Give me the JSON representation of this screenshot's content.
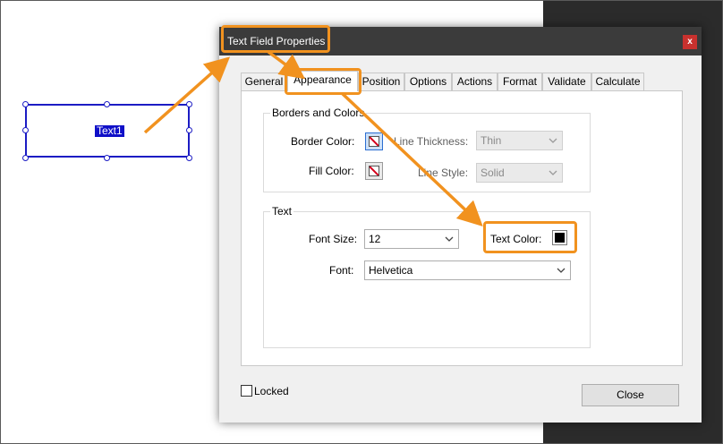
{
  "document": {
    "field_name": "Text1"
  },
  "dialog": {
    "title": "Text Field Properties",
    "close_glyph": "x",
    "tabs": [
      {
        "label": "General"
      },
      {
        "label": "Appearance"
      },
      {
        "label": "Position"
      },
      {
        "label": "Options"
      },
      {
        "label": "Actions"
      },
      {
        "label": "Format"
      },
      {
        "label": "Validate"
      },
      {
        "label": "Calculate"
      }
    ],
    "active_tab": "Appearance",
    "borders_and_colors": {
      "legend": "Borders and Colors",
      "border_color_label": "Border Color:",
      "fill_color_label": "Fill Color:",
      "line_thickness_label": "Line Thickness:",
      "line_thickness_value": "Thin",
      "line_style_label": "Line Style:",
      "line_style_value": "Solid"
    },
    "text": {
      "legend": "Text",
      "font_size_label": "Font Size:",
      "font_size_value": "12",
      "text_color_label": "Text Color:",
      "text_color": "#000000",
      "font_label": "Font:",
      "font_value": "Helvetica"
    },
    "locked_label": "Locked",
    "locked": false,
    "close_button_label": "Close"
  },
  "annotation_color": "#f1921f"
}
